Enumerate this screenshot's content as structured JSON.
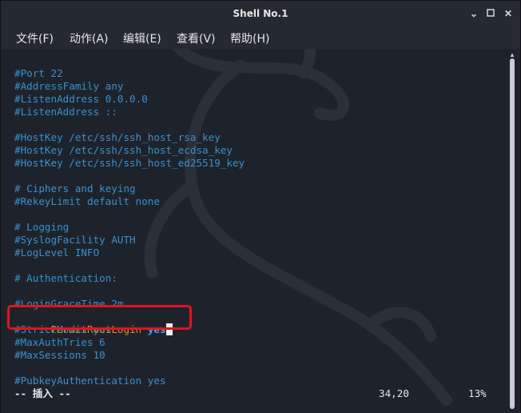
{
  "window": {
    "title": "Shell No.1"
  },
  "menu": [
    {
      "label": "文件(F)"
    },
    {
      "label": "动作(A)"
    },
    {
      "label": "编辑(E)"
    },
    {
      "label": "查看(V)"
    },
    {
      "label": "帮助(H)"
    }
  ],
  "terminal": {
    "lines": [
      {
        "text": "#Port 22",
        "kind": "comment"
      },
      {
        "text": "#AddressFamily any",
        "kind": "comment"
      },
      {
        "text": "#ListenAddress 0.0.0.0",
        "kind": "comment"
      },
      {
        "text": "#ListenAddress ::",
        "kind": "comment"
      },
      {
        "text": "",
        "kind": "comment"
      },
      {
        "text": "#HostKey /etc/ssh/ssh_host_rsa_key",
        "kind": "comment"
      },
      {
        "text": "#HostKey /etc/ssh/ssh_host_ecdsa_key",
        "kind": "comment"
      },
      {
        "text": "#HostKey /etc/ssh/ssh_host_ed25519_key",
        "kind": "comment"
      },
      {
        "text": "",
        "kind": "comment"
      },
      {
        "text": "# Ciphers and keying",
        "kind": "comment"
      },
      {
        "text": "#RekeyLimit default none",
        "kind": "comment"
      },
      {
        "text": "",
        "kind": "comment"
      },
      {
        "text": "# Logging",
        "kind": "comment"
      },
      {
        "text": "#SyslogFacility AUTH",
        "kind": "comment"
      },
      {
        "text": "#LogLevel INFO",
        "kind": "comment"
      },
      {
        "text": "",
        "kind": "comment"
      },
      {
        "text": "# Authentication:",
        "kind": "comment"
      },
      {
        "text": "",
        "kind": "comment"
      },
      {
        "text": "#LoginGraceTime 2m",
        "kind": "comment"
      },
      {
        "text": "",
        "kind": "directive"
      },
      {
        "text": "#StrictModes yes",
        "kind": "comment"
      },
      {
        "text": "#MaxAuthTries 6",
        "kind": "comment"
      },
      {
        "text": "#MaxSessions 10",
        "kind": "comment"
      },
      {
        "text": "",
        "kind": "comment"
      },
      {
        "text": "#PubkeyAuthentication yes",
        "kind": "comment"
      }
    ],
    "directive": {
      "key": "PermitRootLogin",
      "value": "yes"
    },
    "status": {
      "mode": "-- 插入 --",
      "position": "34,20",
      "percent": "13%"
    }
  },
  "colors": {
    "comment": "#3a8fcf",
    "directive_key": "#d98a2b",
    "directive_value": "#4aa3ff",
    "highlight_box": "#e0141e",
    "background": "#1e232b"
  },
  "icons": [
    "minimize-icon",
    "maximize-icon",
    "close-icon",
    "kali-dragon-watermark"
  ]
}
